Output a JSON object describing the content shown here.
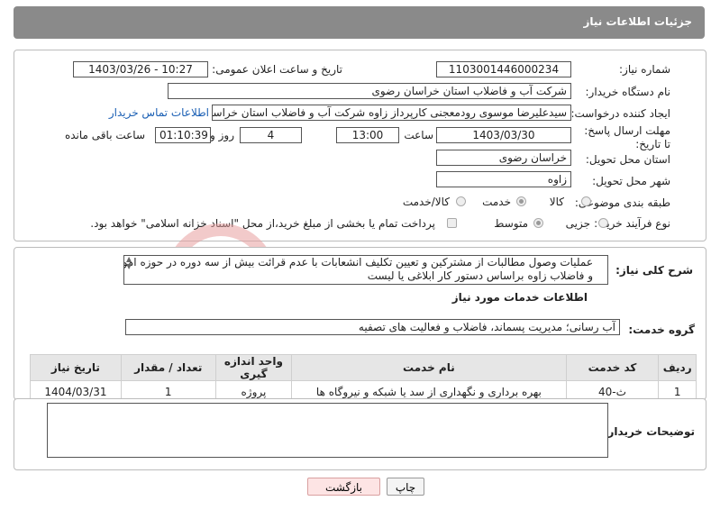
{
  "header": {
    "title": "جزئیات اطلاعات نیاز"
  },
  "form": {
    "need_number_label": "شماره نیاز:",
    "need_number": "1103001446000234",
    "announce_label": "تاریخ و ساعت اعلان عمومی:",
    "announce_value": "1403/03/26 - 10:27",
    "buyer_org_label": "نام دستگاه خریدار:",
    "buyer_org": "شرکت آب و فاضلاب استان خراسان رضوی",
    "creator_label": "ایجاد کننده درخواست:",
    "creator": "سیدعلیرضا موسوی رودمعجنی کارپرداز  زاوه  شرکت آب و فاضلاب استان خراسان رضوی",
    "contact_link": "اطلاعات تماس خریدار",
    "deadline_label": "مهلت ارسال پاسخ: تا تاریخ:",
    "deadline_date": "1403/03/30",
    "time_label": "ساعت",
    "deadline_time": "13:00",
    "days_value": "4",
    "days_label": "روز و",
    "remaining_time": "01:10:39",
    "remaining_label": "ساعت باقی مانده",
    "province_label": "استان محل تحویل:",
    "province": "خراسان رضوی",
    "city_label": "شهر محل تحویل:",
    "city": "زاوه",
    "category_label": "طبقه بندی موضوعی:",
    "category_options": [
      "کالا",
      "خدمت",
      "کالا/خدمت"
    ],
    "category_selected": 1,
    "process_label": "نوع فرآیند خرید :",
    "process_options": [
      "جزیی",
      "متوسط"
    ],
    "process_selected": 0,
    "payment_note": "پرداخت تمام یا بخشی از مبلغ خرید،از محل \"اسناد خزانه اسلامی\" خواهد بود."
  },
  "summary": {
    "label": "شرح کلی نیاز:",
    "line1": "عملیات وصول مطالبات از مشترکین و تعیین تکلیف انشعابات با عدم قرائت بیش از سه دوره در حوزه امور آب",
    "line2": "و فاضلاب زاوه   براساس دستور کار ابلاغی یا لیست"
  },
  "services": {
    "section_title": "اطلاعات خدمات مورد نیاز",
    "group_label": "گروه خدمت:",
    "group_value": "آب رسانی؛ مدیریت پسماند، فاضلاب و فعالیت های تصفیه",
    "columns": [
      "ردیف",
      "کد خدمت",
      "نام خدمت",
      "واحد اندازه گیری",
      "تعداد / مقدار",
      "تاریخ نیاز"
    ],
    "rows": [
      [
        "1",
        "ث-40",
        "بهره برداری و نگهداری از سد یا شبکه و نیروگاه ها",
        "پروژه",
        "1",
        "1404/03/31"
      ]
    ]
  },
  "buyer_notes": {
    "label": "توضیحات خریدار:",
    "value": ""
  },
  "actions": {
    "print": "چاپ",
    "back": "بازگشت"
  },
  "colors": {
    "header_bg": "#8a8a8a",
    "link": "#1a5fb4",
    "watermark": "#e8a0a0"
  }
}
